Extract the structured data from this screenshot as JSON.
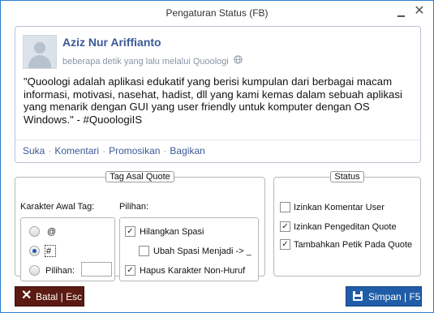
{
  "window": {
    "title": "Pengaturan Status (FB)",
    "close_glyph": "✕"
  },
  "post": {
    "author": "Aziz Nur Ariffianto",
    "meta_text": "beberapa detik  yang lalu melalui Quoologi",
    "body": "\"Quoologi adalah aplikasi edukatif yang berisi kumpulan dari berbagai macam informasi, motivasi, nasehat, hadist, dll yang kami kemas dalam sebuah aplikasi yang menarik dengan GUI yang user friendly untuk komputer dengan OS Windows.\" - #QuoologiIS",
    "actions": [
      "Suka",
      "Komentari",
      "Promosikan",
      "Bagikan"
    ],
    "action_separator": "·"
  },
  "tag_group": {
    "legend": "Tag Asal Quote",
    "awal_label": "Karakter Awal Tag:",
    "radio_options": [
      {
        "label": "@",
        "checked": false
      },
      {
        "label": "#",
        "checked": true
      },
      {
        "label": "Pilihan:",
        "checked": false
      }
    ],
    "custom_value": "",
    "pilihan_label": "Pilihan:",
    "checks": [
      {
        "label": "Hilangkan Spasi",
        "checked": true
      },
      {
        "label": "Ubah Spasi Menjadi -> _",
        "checked": false
      },
      {
        "label": "Hapus Karakter Non-Huruf",
        "checked": true
      }
    ]
  },
  "status_group": {
    "legend": "Status",
    "checks": [
      {
        "label": "Izinkan Komentar User",
        "checked": false
      },
      {
        "label": "Izinkan Pengeditan Quote",
        "checked": true
      },
      {
        "label": "Tambahkan Petik Pada Quote",
        "checked": true
      }
    ]
  },
  "buttons": {
    "cancel": "Batal | Esc",
    "save": "Simpan | F5"
  },
  "colors": {
    "border": "#2a7fd0",
    "link": "#3b5998",
    "cancel_bg": "#5b1b12",
    "save_bg": "#1f5da8"
  }
}
